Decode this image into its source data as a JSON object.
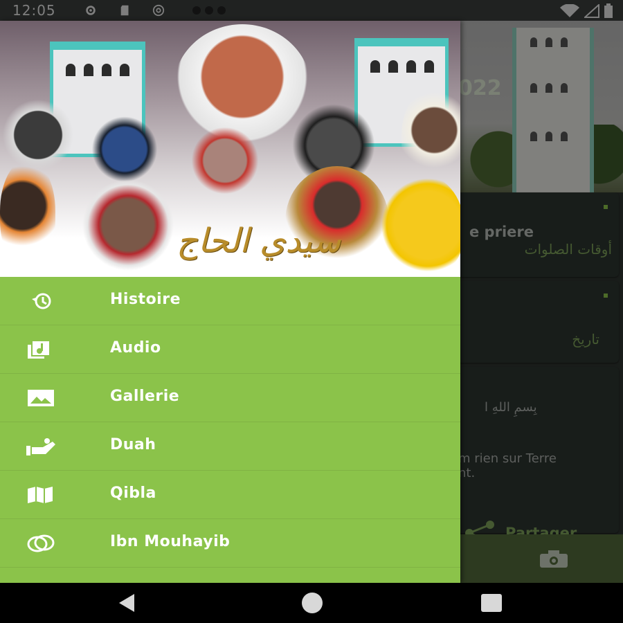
{
  "status_bar": {
    "time": "12:05",
    "left_icons": [
      "settings-icon",
      "sd-card-icon",
      "at-sign-icon",
      "notification-dots-icon"
    ],
    "right_icons": [
      "wifi-icon",
      "signal-icon",
      "battery-icon"
    ]
  },
  "background_app": {
    "hero_year": "022",
    "cards": [
      {
        "title": "e priere",
        "arabic": "أوقات الصلوات"
      },
      {
        "title": "",
        "arabic": "تاريخ"
      },
      {
        "arabic_line": "بِسمِ اللهِ ا",
        "text_line1": "m rien sur Terre",
        "text_line2": "nt."
      }
    ],
    "share_label": "Partager",
    "camera_icon": "camera-icon"
  },
  "drawer": {
    "header_calligraphy": "سيدي الحاج",
    "menu_items": [
      {
        "label": "Histoire",
        "icon": "history-icon"
      },
      {
        "label": "Audio",
        "icon": "audio-library-icon"
      },
      {
        "label": "Gallerie",
        "icon": "image-icon"
      },
      {
        "label": "Duah",
        "icon": "hands-prayer-icon"
      },
      {
        "label": "Qibla",
        "icon": "map-icon"
      },
      {
        "label": "Ibn Mouhayib",
        "icon": "rings-icon"
      },
      {
        "label": "",
        "icon": "partial-icon"
      }
    ]
  },
  "colors": {
    "drawer_green": "#8bc34a",
    "accent_text_green": "#7ea35a",
    "minaret_teal": "#4cc4bd"
  },
  "nav_bar": {
    "back": "back-icon",
    "home": "home-icon",
    "recents": "recents-icon"
  }
}
